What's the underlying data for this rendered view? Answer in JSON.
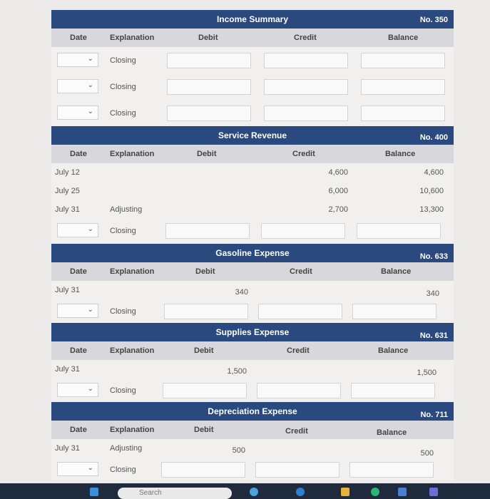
{
  "headers": {
    "date": "Date",
    "explanation": "Explanation",
    "debit": "Debit",
    "credit": "Credit",
    "balance": "Balance"
  },
  "closing_label": "Closing",
  "ledgers": [
    {
      "title": "Income Summary",
      "no": "No. 350",
      "rows": []
    },
    {
      "title": "Service Revenue",
      "no": "No. 400",
      "rows": [
        {
          "date": "July 12",
          "explanation": "",
          "debit": "",
          "credit": "4,600",
          "balance": "4,600"
        },
        {
          "date": "July 25",
          "explanation": "",
          "debit": "",
          "credit": "6,000",
          "balance": "10,600"
        },
        {
          "date": "July 31",
          "explanation": "Adjusting",
          "debit": "",
          "credit": "2,700",
          "balance": "13,300"
        }
      ]
    },
    {
      "title": "Gasoline Expense",
      "no": "No. 633",
      "rows": [
        {
          "date": "July 31",
          "explanation": "",
          "debit": "340",
          "credit": "",
          "balance": "340"
        }
      ]
    },
    {
      "title": "Supplies Expense",
      "no": "No. 631",
      "rows": [
        {
          "date": "July 31",
          "explanation": "",
          "debit": "1,500",
          "credit": "",
          "balance": "1,500"
        }
      ]
    },
    {
      "title": "Depreciation Expense",
      "no": "No. 711",
      "rows": [
        {
          "date": "July 31",
          "explanation": "Adjusting",
          "debit": "500",
          "credit": "",
          "balance": "500"
        }
      ]
    }
  ],
  "taskbar": {
    "search_label": "Search"
  }
}
